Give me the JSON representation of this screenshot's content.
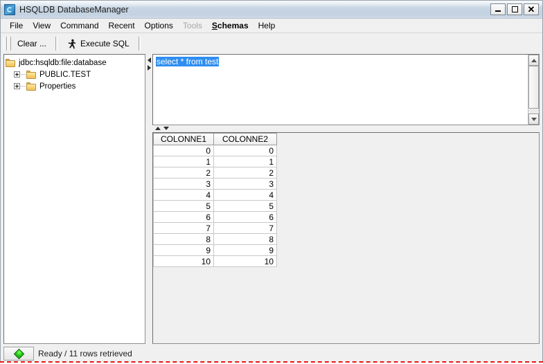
{
  "window": {
    "title": "HSQLDB DatabaseManager",
    "app_icon": "hsqldb-app-icon",
    "controls": {
      "minimize": "minimize-icon",
      "maximize": "maximize-icon",
      "close": "✕"
    }
  },
  "menubar": {
    "items": [
      {
        "label": "File",
        "disabled": false,
        "bold": false
      },
      {
        "label": "View",
        "disabled": false,
        "bold": false
      },
      {
        "label": "Command",
        "disabled": false,
        "bold": false
      },
      {
        "label": "Recent",
        "disabled": false,
        "bold": false
      },
      {
        "label": "Options",
        "disabled": false,
        "bold": false
      },
      {
        "label": "Tools",
        "disabled": true,
        "bold": false
      },
      {
        "label": "Schemas",
        "disabled": false,
        "bold": true,
        "mnemonic": "S",
        "rest": "chemas"
      },
      {
        "label": "Help",
        "disabled": false,
        "bold": false
      }
    ]
  },
  "toolbar": {
    "clear_label": "Clear ...",
    "execute_label": "Execute SQL",
    "execute_icon": "running-man-icon"
  },
  "tree": {
    "root": {
      "label": "jdbc:hsqldb:file:database",
      "icon": "folder-icon"
    },
    "children": [
      {
        "label": "PUBLIC.TEST",
        "icon": "folder-icon",
        "expander": "plus-box-icon"
      },
      {
        "label": "Properties",
        "icon": "folder-icon",
        "expander": "plus-box-icon"
      }
    ]
  },
  "editor": {
    "sql": "select * from test",
    "selected": true
  },
  "results": {
    "columns": [
      "COLONNE1",
      "COLONNE2"
    ],
    "rows": [
      [
        "0",
        "0"
      ],
      [
        "1",
        "1"
      ],
      [
        "2",
        "2"
      ],
      [
        "3",
        "3"
      ],
      [
        "4",
        "4"
      ],
      [
        "5",
        "5"
      ],
      [
        "6",
        "6"
      ],
      [
        "7",
        "7"
      ],
      [
        "8",
        "8"
      ],
      [
        "9",
        "9"
      ],
      [
        "10",
        "10"
      ]
    ]
  },
  "statusbar": {
    "text": "Ready / 11 rows retrieved",
    "indicator": "green-diamond-icon",
    "indicator_color": "#22cc14"
  },
  "colors": {
    "titlebar": "#c9d7e4",
    "selection": "#2f8ef0",
    "folder": "#f8d173",
    "panel": "#f0f0f0"
  }
}
